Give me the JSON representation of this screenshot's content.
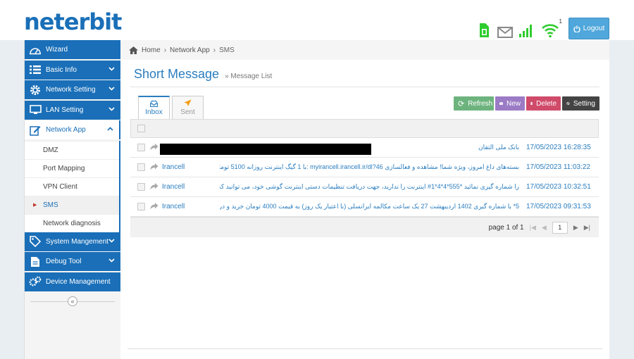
{
  "brand": {
    "logo_text": "neterbit"
  },
  "header": {
    "logout_label": "Logout",
    "wifi_clients": "1",
    "colors": {
      "sim": "#2ecc2e",
      "signal": "#2ecc2e",
      "wifi": "#2ecc2e",
      "mail": "#888888"
    }
  },
  "sidebar": {
    "items": [
      {
        "label": "Wizard",
        "icon": "wizard-icon"
      },
      {
        "label": "Basic Info",
        "icon": "list-icon"
      },
      {
        "label": "Network Setting",
        "icon": "gear-icon"
      },
      {
        "label": "LAN Setting",
        "icon": "monitor-icon"
      },
      {
        "label": "Network App",
        "icon": "edit-icon"
      },
      {
        "label": "System Mangement",
        "icon": "tag-icon"
      },
      {
        "label": "Debug Tool",
        "icon": "document-icon"
      },
      {
        "label": "Device Management",
        "icon": "gears-icon"
      }
    ],
    "network_app_sub": [
      "DMZ",
      "Port Mapping",
      "VPN Client",
      "SMS",
      "Network diagnosis"
    ],
    "collapse_glyph": "«"
  },
  "breadcrumb": {
    "home": "Home",
    "section": "Network App",
    "current": "SMS"
  },
  "page": {
    "title": "Short Message",
    "subtitle": "» Message List"
  },
  "tabs": [
    {
      "label": "Inbox"
    },
    {
      "label": "Sent"
    }
  ],
  "actions": {
    "refresh": "Refresh",
    "new": "New",
    "delete": "Delete",
    "setting": "Setting"
  },
  "messages": [
    {
      "sender": "",
      "content": "بانک ملی التقان",
      "date": "17/05/2023 16:28:35",
      "redacted": true
    },
    {
      "sender": "Irancell",
      "content": "بسته‌های داغ امروز، ویژه شما! مشاهده و فعالسازی myirancell.irancell.ir/dl?46 :با 1 گیگ اینترنت روزانه 5100 تومان",
      "date": "17/05/2023 11:03:22"
    },
    {
      "sender": "Irancell",
      "content": "را شماره گیری نمائید *555*4*4*1# اینترنت را ندارید، جهت دریافت تنظیمات دستی اینترنت گوشی خود، می توانید کد دستوری",
      "date": "17/05/2023 10:32:51"
    },
    {
      "sender": "Irancell",
      "content": "5* با شماره گیری 1402 اردیبهشت 27 یک ساعت مکالمه ایرانسلی (با اعتبار یک روز) به قیمت 4000 تومان خرید و دریافت در",
      "date": "17/05/2023 09:31:53"
    }
  ],
  "pager": {
    "label": "page 1 of 1",
    "value": "1"
  }
}
